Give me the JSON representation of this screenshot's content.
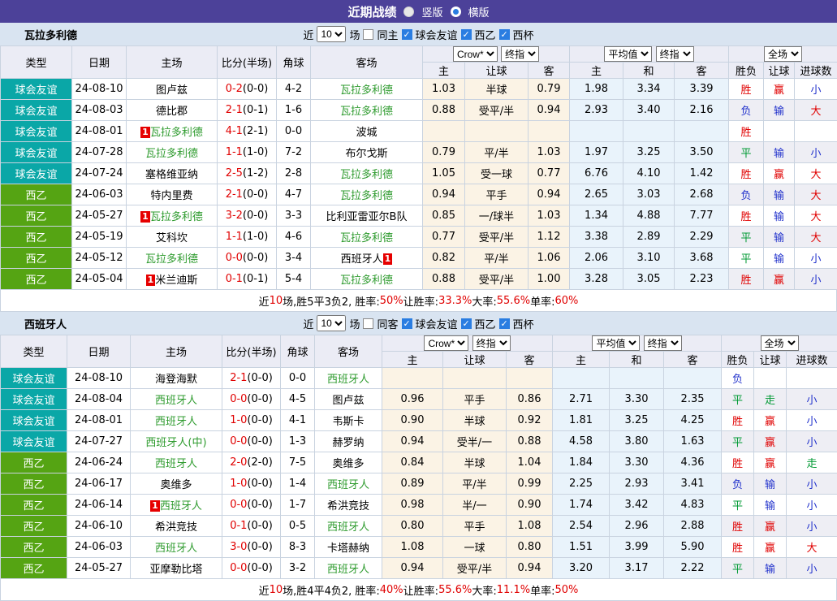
{
  "header_bar": {
    "title": "近期战绩",
    "radio_vertical": "竖版",
    "radio_horizontal": "横版",
    "selected": "横版"
  },
  "columns": {
    "type": "类型",
    "date": "日期",
    "home": "主场",
    "score": "比分(半场)",
    "corner": "角球",
    "away": "客场",
    "odds_select1": "Crow*",
    "odds_select2": "终指",
    "odds_cols": [
      "主",
      "让球",
      "客"
    ],
    "avg_select1": "平均值",
    "avg_select2": "终指",
    "avg_cols": [
      "主",
      "和",
      "客"
    ],
    "full_select": "全场",
    "full_cols": [
      "胜负",
      "让球",
      "进球数"
    ]
  },
  "colors": {
    "title_bar": "#4c4199",
    "friendly_badge": "#0aa7a7",
    "league_badge": "#55a413",
    "team_highlight": "#2e9b2e",
    "red": "#e00000",
    "blue": "#2333cc",
    "green": "#009933",
    "odds_bg": "#fbf3e5",
    "avg_bg": "#e9f3fb",
    "stripe_bg": "#eeeef4",
    "filter_band_bg": "#d9e4f1",
    "header_bg": "#ebecf5"
  },
  "sections": [
    {
      "team": "瓦拉多利德",
      "filter": {
        "near": "近",
        "count": "10",
        "games": "场",
        "same": "同主",
        "same_checked": false,
        "leagues": [
          {
            "label": "球会友谊",
            "checked": true
          },
          {
            "label": "西乙",
            "checked": true
          },
          {
            "label": "西杯",
            "checked": true
          }
        ]
      },
      "rows": [
        {
          "league": "球会友谊",
          "league_type": "friendly",
          "date": "24-08-10",
          "home": {
            "name": "图卢兹",
            "green": false
          },
          "score": "0-2",
          "half": "(0-0)",
          "corner": "4-2",
          "away": {
            "name": "瓦拉多利德",
            "green": true
          },
          "odds": [
            "1.03",
            "半球",
            "0.79"
          ],
          "avg": [
            "1.98",
            "3.34",
            "3.39"
          ],
          "result": [
            "胜",
            "赢",
            "小"
          ]
        },
        {
          "league": "球会友谊",
          "league_type": "friendly",
          "date": "24-08-03",
          "home": {
            "name": "德比郡",
            "green": false
          },
          "score": "2-1",
          "half": "(0-1)",
          "corner": "1-6",
          "away": {
            "name": "瓦拉多利德",
            "green": true
          },
          "odds": [
            "0.88",
            "受平/半",
            "0.94"
          ],
          "avg": [
            "2.93",
            "3.40",
            "2.16"
          ],
          "result": [
            "负",
            "输",
            "大"
          ]
        },
        {
          "league": "球会友谊",
          "league_type": "friendly",
          "date": "24-08-01",
          "home": {
            "name": "瓦拉多利德",
            "green": true,
            "badge_text": "1",
            "badge_pos": "before"
          },
          "score": "4-1",
          "half": "(2-1)",
          "corner": "0-0",
          "away": {
            "name": "波城",
            "green": false
          },
          "odds": [
            "",
            "",
            ""
          ],
          "avg": [
            "",
            "",
            ""
          ],
          "result": [
            "胜",
            "",
            ""
          ]
        },
        {
          "league": "球会友谊",
          "league_type": "friendly",
          "date": "24-07-28",
          "home": {
            "name": "瓦拉多利德",
            "green": true
          },
          "score": "1-1",
          "half": "(1-0)",
          "corner": "7-2",
          "away": {
            "name": "布尔戈斯",
            "green": false
          },
          "odds": [
            "0.79",
            "平/半",
            "1.03"
          ],
          "avg": [
            "1.97",
            "3.25",
            "3.50"
          ],
          "result": [
            "平",
            "输",
            "小"
          ]
        },
        {
          "league": "球会友谊",
          "league_type": "friendly",
          "date": "24-07-24",
          "home": {
            "name": "塞格维亚纳",
            "green": false
          },
          "score": "2-5",
          "half": "(1-2)",
          "corner": "2-8",
          "away": {
            "name": "瓦拉多利德",
            "green": true
          },
          "odds": [
            "1.05",
            "受一球",
            "0.77"
          ],
          "avg": [
            "6.76",
            "4.10",
            "1.42"
          ],
          "result": [
            "胜",
            "赢",
            "大"
          ]
        },
        {
          "league": "西乙",
          "league_type": "d2",
          "date": "24-06-03",
          "home": {
            "name": "特内里费",
            "green": false
          },
          "score": "2-1",
          "half": "(0-0)",
          "corner": "4-7",
          "away": {
            "name": "瓦拉多利德",
            "green": true
          },
          "odds": [
            "0.94",
            "平手",
            "0.94"
          ],
          "avg": [
            "2.65",
            "3.03",
            "2.68"
          ],
          "result": [
            "负",
            "输",
            "大"
          ]
        },
        {
          "league": "西乙",
          "league_type": "d2",
          "date": "24-05-27",
          "home": {
            "name": "瓦拉多利德",
            "green": true,
            "badge_text": "1",
            "badge_pos": "before"
          },
          "score": "3-2",
          "half": "(0-0)",
          "corner": "3-3",
          "away": {
            "name": "比利亚雷亚尔B队",
            "green": false
          },
          "odds": [
            "0.85",
            "一/球半",
            "1.03"
          ],
          "avg": [
            "1.34",
            "4.88",
            "7.77"
          ],
          "result": [
            "胜",
            "输",
            "大"
          ]
        },
        {
          "league": "西乙",
          "league_type": "d2",
          "date": "24-05-19",
          "home": {
            "name": "艾科坎",
            "green": false
          },
          "score": "1-1",
          "half": "(1-0)",
          "corner": "4-6",
          "away": {
            "name": "瓦拉多利德",
            "green": true
          },
          "odds": [
            "0.77",
            "受平/半",
            "1.12"
          ],
          "avg": [
            "3.38",
            "2.89",
            "2.29"
          ],
          "result": [
            "平",
            "输",
            "大"
          ]
        },
        {
          "league": "西乙",
          "league_type": "d2",
          "date": "24-05-12",
          "home": {
            "name": "瓦拉多利德",
            "green": true
          },
          "score": "0-0",
          "half": "(0-0)",
          "corner": "3-4",
          "away": {
            "name": "西班牙人",
            "green": false,
            "badge_text": "1",
            "badge_pos": "after"
          },
          "odds": [
            "0.82",
            "平/半",
            "1.06"
          ],
          "avg": [
            "2.06",
            "3.10",
            "3.68"
          ],
          "result": [
            "平",
            "输",
            "小"
          ]
        },
        {
          "league": "西乙",
          "league_type": "d2",
          "date": "24-05-04",
          "home": {
            "name": "米兰迪斯",
            "green": false,
            "badge_text": "1",
            "badge_pos": "before"
          },
          "score": "0-1",
          "half": "(0-1)",
          "corner": "5-4",
          "away": {
            "name": "瓦拉多利德",
            "green": true
          },
          "odds": [
            "0.88",
            "受平/半",
            "1.00"
          ],
          "avg": [
            "3.28",
            "3.05",
            "2.23"
          ],
          "result": [
            "胜",
            "赢",
            "小"
          ]
        }
      ],
      "summary": [
        [
          "近",
          0
        ],
        [
          "10",
          1
        ],
        [
          "场,胜5平3负2, 胜率:",
          0
        ],
        [
          "50%",
          1
        ],
        [
          " 让胜率:",
          0
        ],
        [
          "33.3%",
          1
        ],
        [
          " 大率:",
          0
        ],
        [
          "55.6%",
          1
        ],
        [
          " 单率:",
          0
        ],
        [
          "60%",
          1
        ]
      ]
    },
    {
      "team": "西班牙人",
      "filter": {
        "near": "近",
        "count": "10",
        "games": "场",
        "same": "同客",
        "same_checked": false,
        "leagues": [
          {
            "label": "球会友谊",
            "checked": true
          },
          {
            "label": "西乙",
            "checked": true
          },
          {
            "label": "西杯",
            "checked": true
          }
        ]
      },
      "rows": [
        {
          "league": "球会友谊",
          "league_type": "friendly",
          "date": "24-08-10",
          "home": {
            "name": "海登海默",
            "green": false
          },
          "score": "2-1",
          "half": "(0-0)",
          "corner": "0-0",
          "away": {
            "name": "西班牙人",
            "green": true
          },
          "odds": [
            "",
            "",
            ""
          ],
          "avg": [
            "",
            "",
            ""
          ],
          "result": [
            "负",
            "",
            ""
          ]
        },
        {
          "league": "球会友谊",
          "league_type": "friendly",
          "date": "24-08-04",
          "home": {
            "name": "西班牙人",
            "green": true
          },
          "score": "0-0",
          "half": "(0-0)",
          "corner": "4-5",
          "away": {
            "name": "图卢兹",
            "green": false
          },
          "odds": [
            "0.96",
            "平手",
            "0.86"
          ],
          "avg": [
            "2.71",
            "3.30",
            "2.35"
          ],
          "result": [
            "平",
            "走",
            "小"
          ]
        },
        {
          "league": "球会友谊",
          "league_type": "friendly",
          "date": "24-08-01",
          "home": {
            "name": "西班牙人",
            "green": true
          },
          "score": "1-0",
          "half": "(0-0)",
          "corner": "4-1",
          "away": {
            "name": "韦斯卡",
            "green": false
          },
          "odds": [
            "0.90",
            "半球",
            "0.92"
          ],
          "avg": [
            "1.81",
            "3.25",
            "4.25"
          ],
          "result": [
            "胜",
            "赢",
            "小"
          ]
        },
        {
          "league": "球会友谊",
          "league_type": "friendly",
          "date": "24-07-27",
          "home": {
            "name": "西班牙人(中)",
            "green": true
          },
          "score": "0-0",
          "half": "(0-0)",
          "corner": "1-3",
          "away": {
            "name": "赫罗纳",
            "green": false
          },
          "odds": [
            "0.94",
            "受半/一",
            "0.88"
          ],
          "avg": [
            "4.58",
            "3.80",
            "1.63"
          ],
          "result": [
            "平",
            "赢",
            "小"
          ]
        },
        {
          "league": "西乙",
          "league_type": "d2",
          "date": "24-06-24",
          "home": {
            "name": "西班牙人",
            "green": true
          },
          "score": "2-0",
          "half": "(2-0)",
          "corner": "7-5",
          "away": {
            "name": "奥维多",
            "green": false
          },
          "odds": [
            "0.84",
            "半球",
            "1.04"
          ],
          "avg": [
            "1.84",
            "3.30",
            "4.36"
          ],
          "result": [
            "胜",
            "赢",
            "走"
          ]
        },
        {
          "league": "西乙",
          "league_type": "d2",
          "date": "24-06-17",
          "home": {
            "name": "奥维多",
            "green": false
          },
          "score": "1-0",
          "half": "(0-0)",
          "corner": "1-4",
          "away": {
            "name": "西班牙人",
            "green": true
          },
          "odds": [
            "0.89",
            "平/半",
            "0.99"
          ],
          "avg": [
            "2.25",
            "2.93",
            "3.41"
          ],
          "result": [
            "负",
            "输",
            "小"
          ]
        },
        {
          "league": "西乙",
          "league_type": "d2",
          "date": "24-06-14",
          "home": {
            "name": "西班牙人",
            "green": true,
            "badge_text": "1",
            "badge_pos": "before"
          },
          "score": "0-0",
          "half": "(0-0)",
          "corner": "1-7",
          "away": {
            "name": "希洪竞技",
            "green": false
          },
          "odds": [
            "0.98",
            "半/一",
            "0.90"
          ],
          "avg": [
            "1.74",
            "3.42",
            "4.83"
          ],
          "result": [
            "平",
            "输",
            "小"
          ]
        },
        {
          "league": "西乙",
          "league_type": "d2",
          "date": "24-06-10",
          "home": {
            "name": "希洪竞技",
            "green": false
          },
          "score": "0-1",
          "half": "(0-0)",
          "corner": "0-5",
          "away": {
            "name": "西班牙人",
            "green": true
          },
          "odds": [
            "0.80",
            "平手",
            "1.08"
          ],
          "avg": [
            "2.54",
            "2.96",
            "2.88"
          ],
          "result": [
            "胜",
            "赢",
            "小"
          ]
        },
        {
          "league": "西乙",
          "league_type": "d2",
          "date": "24-06-03",
          "home": {
            "name": "西班牙人",
            "green": true
          },
          "score": "3-0",
          "half": "(0-0)",
          "corner": "8-3",
          "away": {
            "name": "卡塔赫纳",
            "green": false
          },
          "odds": [
            "1.08",
            "一球",
            "0.80"
          ],
          "avg": [
            "1.51",
            "3.99",
            "5.90"
          ],
          "result": [
            "胜",
            "赢",
            "大"
          ]
        },
        {
          "league": "西乙",
          "league_type": "d2",
          "date": "24-05-27",
          "home": {
            "name": "亚摩勒比塔",
            "green": false
          },
          "score": "0-0",
          "half": "(0-0)",
          "corner": "3-2",
          "away": {
            "name": "西班牙人",
            "green": true
          },
          "odds": [
            "0.94",
            "受平/半",
            "0.94"
          ],
          "avg": [
            "3.20",
            "3.17",
            "2.22"
          ],
          "result": [
            "平",
            "输",
            "小"
          ]
        }
      ],
      "summary": [
        [
          "近",
          0
        ],
        [
          "10",
          1
        ],
        [
          "场,胜4平4负2, 胜率:",
          0
        ],
        [
          "40%",
          1
        ],
        [
          " 让胜率:",
          0
        ],
        [
          "55.6%",
          1
        ],
        [
          " 大率:",
          0
        ],
        [
          "11.1%",
          1
        ],
        [
          " 单率:",
          0
        ],
        [
          "50%",
          1
        ]
      ]
    }
  ]
}
